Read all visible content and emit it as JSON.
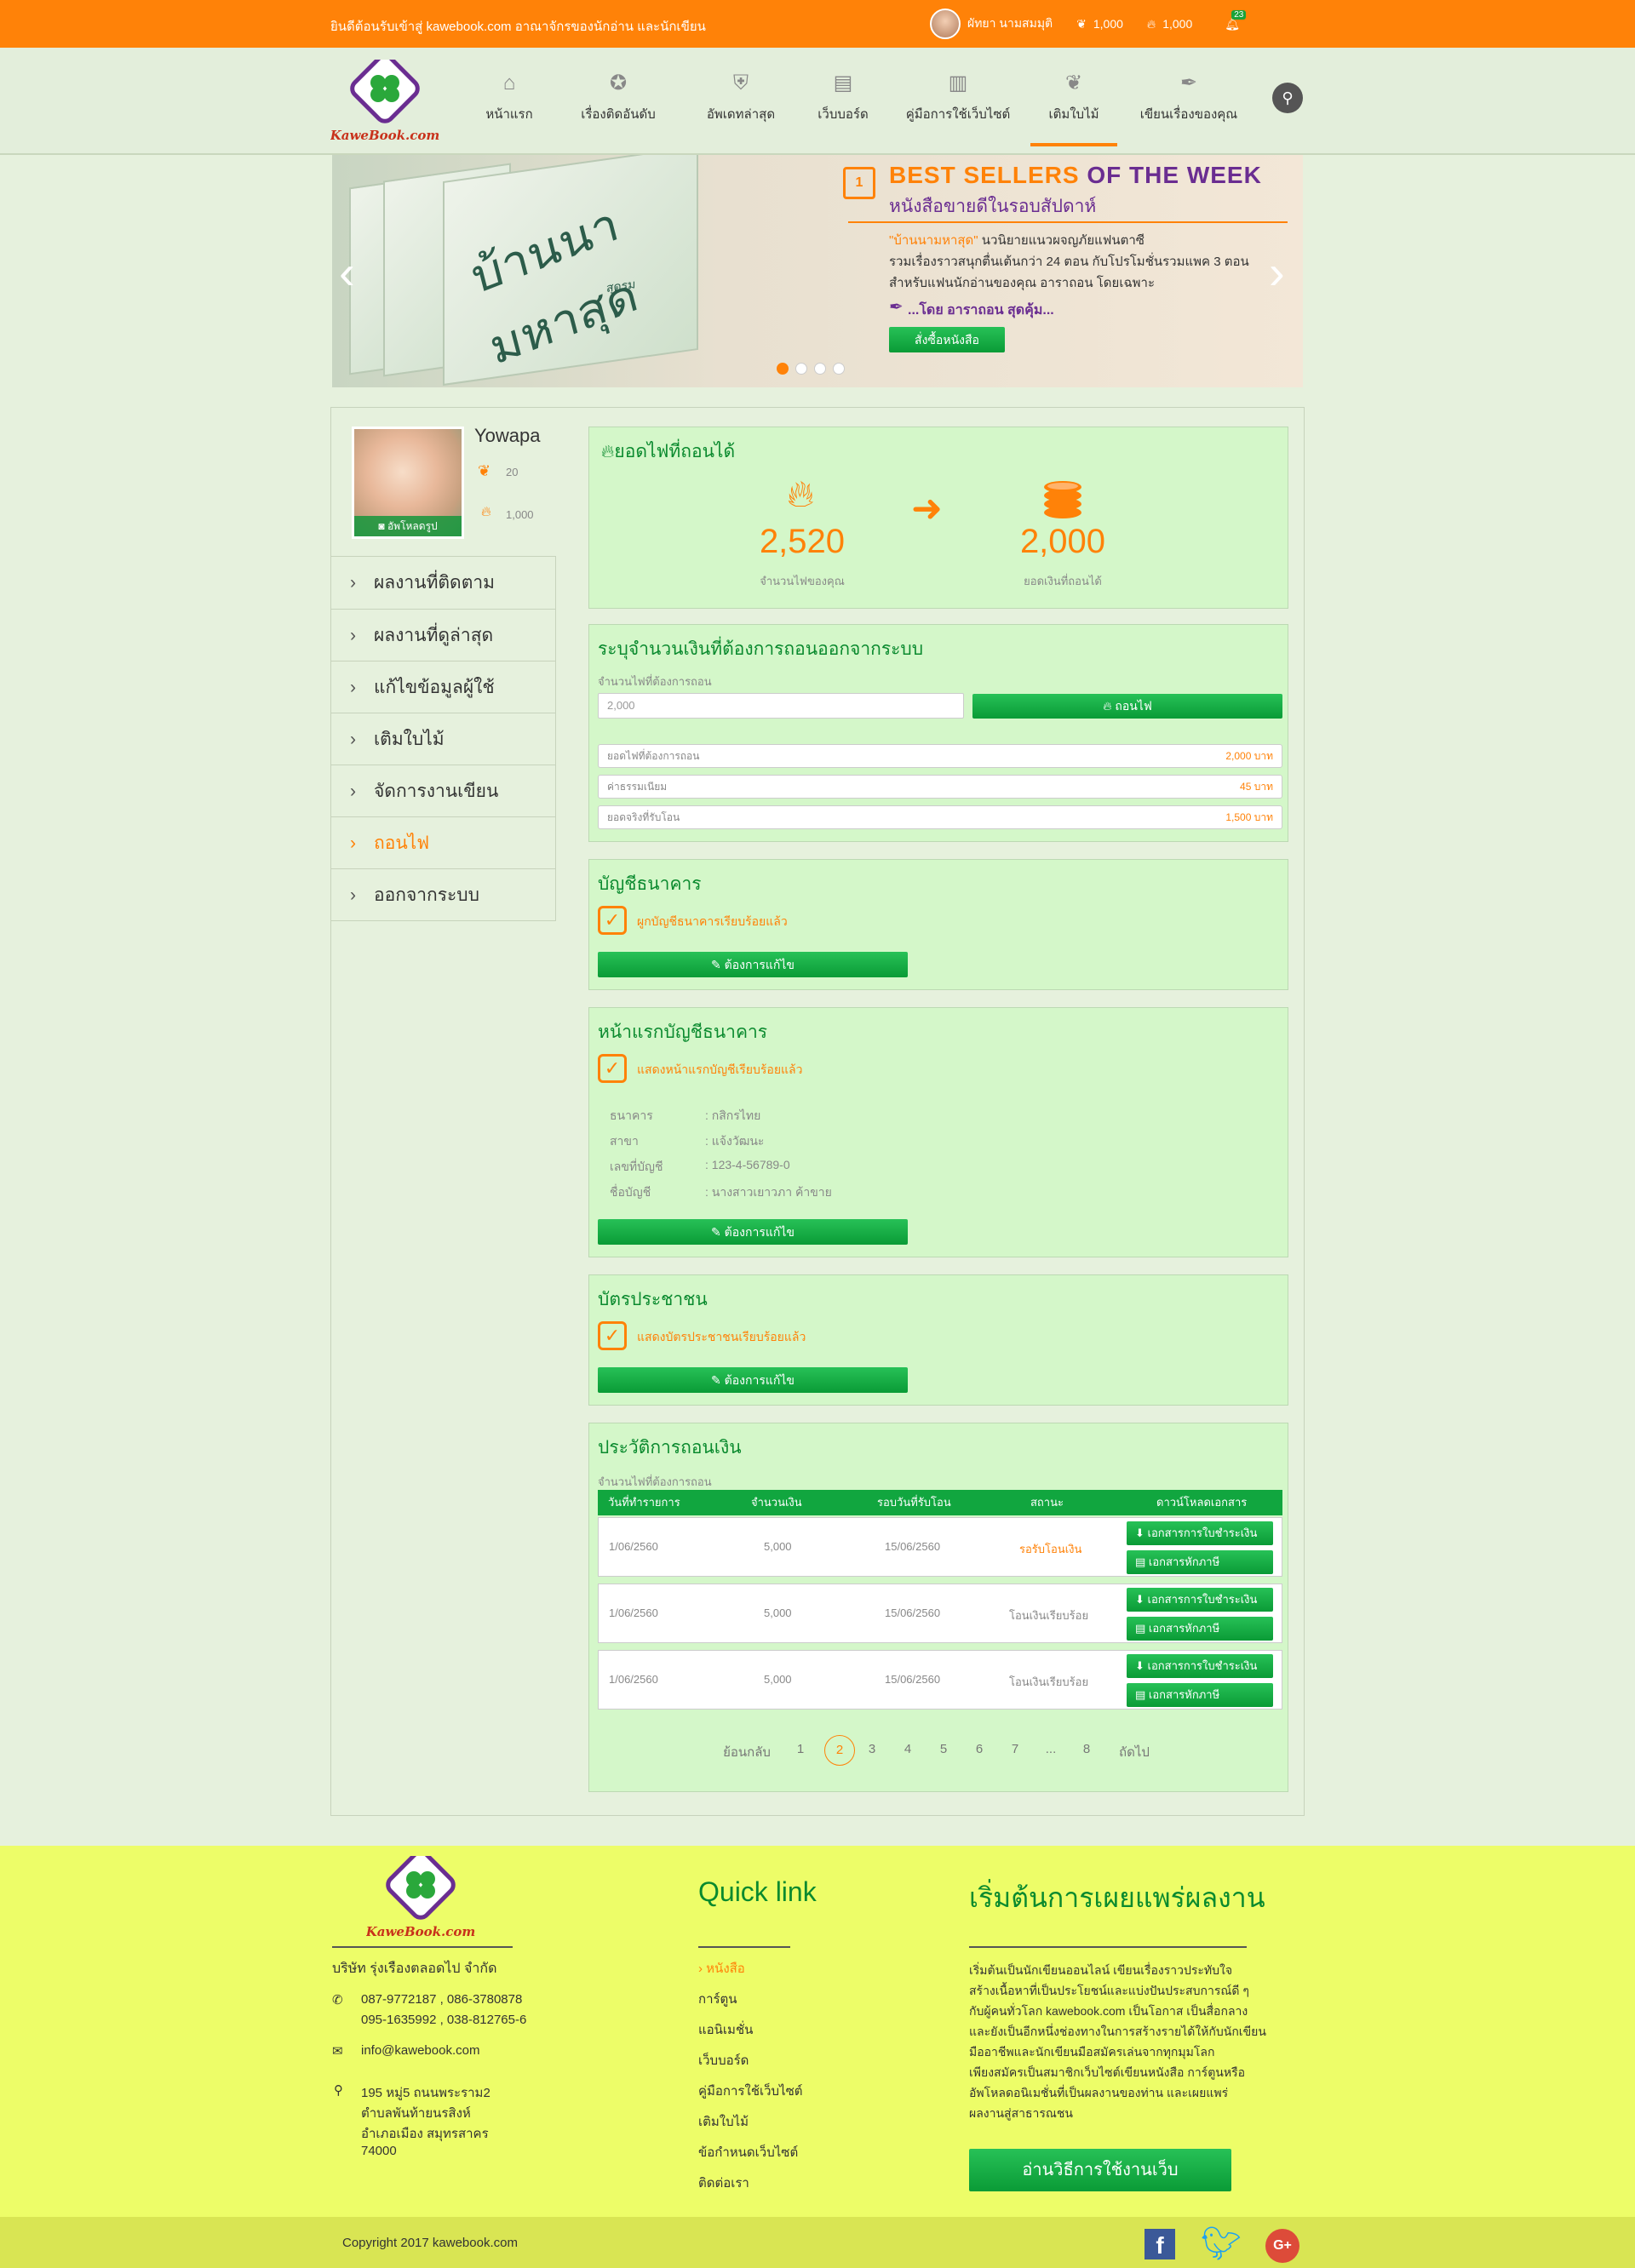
{
  "topbar": {
    "welcome": "ยินดีต้อนรับเข้าสู่ kawebook.com อาณาจักรของนักอ่าน และนักเขียน",
    "user_name": "ผัทยา นามสมมุติ",
    "leaves": "1,000",
    "fire": "1,000",
    "notif_count": "23"
  },
  "nav": {
    "logo_text": "KaweBook.com",
    "items": [
      "หน้าแรก",
      "เรื่องติดอันดับ",
      "อัพเดทล่าสุด",
      "เว็บบอร์ด",
      "คู่มือการใช้เว็บไซต์",
      "เติมใบไม้",
      "เขียนเรื่องของคุณ"
    ],
    "active": "เติมใบไม้"
  },
  "banner": {
    "book_title": "บ้านนามหาสุด",
    "book_author_on_cover": "สุดรม",
    "best": "BEST SELLERS",
    "of_week": "OF THE WEEK",
    "subtitle": "หนังสือขายดีในรอบสัปดาห์",
    "rank": "1",
    "line1_hl": "\"บ้านนามหาสุด\"",
    "line1": " นวนิยายแนวผจญภัยแฟนตาซี",
    "line2": "รวมเรื่องราวสนุกตื่นเต้นกว่า 24 ตอน กับโปรโมชั่นรวมแพค 3 ตอน",
    "line3": "สำหรับแฟนนักอ่านของคุณ อาราถอน โดยเฉพาะ",
    "author": "...โดย อาราถอน สุดคุ้ม...",
    "buy": "สั่งซื้อหนังสือ"
  },
  "profile": {
    "name": "Yowapa",
    "leaves": "20",
    "fire": "1,000",
    "upload": "อัพโหลดรูป"
  },
  "sidebar": [
    "ผลงานที่ติดตาม",
    "ผลงานที่ดูล่าสุด",
    "แก้ไขข้อมูลผู้ใช้",
    "เติมใบไม้",
    "จัดการงานเขียน",
    "ถอนไฟ",
    "ออกจากระบบ"
  ],
  "sidebar_active": "ถอนไฟ",
  "withdraw_card": {
    "title": "ยอดไฟที่ถอนได้",
    "fire_value": "2,520",
    "fire_label": "จำนวนไฟของคุณ",
    "money_value": "2,000",
    "money_label": "ยอดเงินที่ถอนได้"
  },
  "form_card": {
    "title": "ระบุจำนวนเงินที่ต้องการถอนออกจากระบบ",
    "label": "จำนวนไฟที่ต้องการถอน",
    "input_value": "2,000",
    "button": "ถอนไฟ",
    "rows": [
      {
        "label": "ยอดไฟที่ต้องการถอน",
        "value": "2,000 บาท"
      },
      {
        "label": "ค่าธรรมเนียม",
        "value": "45 บาท"
      },
      {
        "label": "ยอดจริงที่รับโอน",
        "value": "1,500 บาท"
      }
    ]
  },
  "bank_card": {
    "title": "บัญชีธนาคาร",
    "status": "ผูกบัญชีธนาคารเรียบร้อยแล้ว",
    "button": "ต้องการแก้ไข"
  },
  "bookbank_card": {
    "title": "หน้าแรกบัญชีธนาคาร",
    "status": "แสดงหน้าแรกบัญชีเรียบร้อยแล้ว",
    "fields": [
      {
        "label": "ธนาคาร",
        "value": ": กสิกรไทย"
      },
      {
        "label": "สาขา",
        "value": ": แจ้งวัฒนะ"
      },
      {
        "label": "เลขที่บัญชี",
        "value": ": 123-4-56789-0"
      },
      {
        "label": "ชื่อบัญชี",
        "value": ": นางสาวเยาวภา ค้าขาย"
      }
    ],
    "button": "ต้องการแก้ไข"
  },
  "idcard_card": {
    "title": "บัตรประชาชน",
    "status": "แสดงบัตรประชาชนเรียบร้อยแล้ว",
    "button": "ต้องการแก้ไข"
  },
  "history_card": {
    "title": "ประวัติการถอนเงิน",
    "label": "จำนวนไฟที่ต้องการถอน",
    "headers": [
      "วันที่ทำรายการ",
      "จำนวนเงิน",
      "รอบวันที่รับโอน",
      "สถานะ",
      "ดาวน์โหลดเอกสาร"
    ],
    "rows": [
      {
        "date": "1/06/2560",
        "amount": "5,000",
        "transfer": "15/06/2560",
        "status": "รอรับโอนเงิน"
      },
      {
        "date": "1/06/2560",
        "amount": "5,000",
        "transfer": "15/06/2560",
        "status": "โอนเงินเรียบร้อย"
      },
      {
        "date": "1/06/2560",
        "amount": "5,000",
        "transfer": "15/06/2560",
        "status": "โอนเงินเรียบร้อย"
      }
    ],
    "dl1": "เอกสารการใบชำระเงิน",
    "dl2": "เอกสารหักภาษี",
    "pagination": {
      "prev": "ย้อนกลับ",
      "pages": [
        "1",
        "2",
        "3",
        "4",
        "5",
        "6",
        "7",
        "...",
        "8"
      ],
      "current": "2",
      "next": "ถัดไป"
    }
  },
  "footer": {
    "logo_text": "KaweBook.com",
    "company": "บริษัท รุ่งเรืองตลอดไป จำกัด",
    "phone1": "087-9772187 , 086-3780878",
    "phone2": "095-1635992 , 038-812765-6",
    "email": "info@kawebook.com",
    "addr1": "195 หมู่5 ถนนพระราม2",
    "addr2": "ตำบลพันท้ายนรสิงห์",
    "addr3": "อำเภอเมือง สมุทรสาคร",
    "addr4": "74000",
    "quick_title": "Quick link",
    "quick_links": [
      "หนังสือ",
      "การ์ตูน",
      "แอนิเมชั่น",
      "เว็บบอร์ด",
      "คู่มือการใช้เว็บไซต์",
      "เติมใบไม้",
      "ข้อกำหนดเว็บไซต์",
      "ติดต่อเรา"
    ],
    "start_title": "เริ่มต้นการเผยแพร่ผลงาน",
    "start_text": [
      "เริ่มต้นเป็นนักเขียนออนไลน์ เขียนเรื่องราวประทับใจ",
      "สร้างเนื้อหาที่เป็นประโยชน์และแบ่งปันประสบการณ์ดี ๆ",
      "กับผู้คนทั่วโลก kawebook.com เป็นโอกาส เป็นสื่อกลาง",
      "และยังเป็นอีกหนึ่งช่องทางในการสร้างรายได้ให้กับนักเขียน",
      "มืออาชีพและนักเขียนมือสมัครเล่นจากทุกมุมโลก",
      "เพียงสมัครเป็นสมาชิกเว็บไซต์เขียนหนังสือ การ์ตูนหรือ",
      "อัพโหลดอนิเมชั่นที่เป็นผลงานของท่าน และเผยแพร่",
      "ผลงานสู่สาธารณชน"
    ],
    "how_btn": "อ่านวิธีการใช้งานเว็บ",
    "copyright": "Copyright 2017 kawebook.com"
  }
}
